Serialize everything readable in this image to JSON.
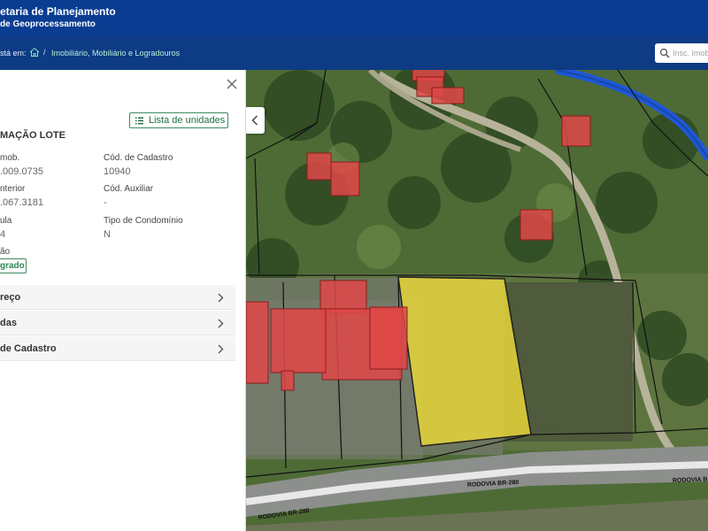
{
  "header": {
    "title_line1": "etaria de Planejamento",
    "title_line2": "de Geoprocessamento"
  },
  "breadcrumb": {
    "you_are_label": "stá em:",
    "separator": "/",
    "current": "Imobiliário, Mobiliário e Logradouros"
  },
  "search": {
    "placeholder": "Insc. Imob"
  },
  "panel": {
    "units_button_label": "Lista de unidades",
    "title": "MAÇÃO LOTE",
    "fields": [
      {
        "label": "mob.",
        "value": ".009.0735"
      },
      {
        "label": "Cód. de Cadastro",
        "value": "10940"
      },
      {
        "label": "nterior",
        "value": ".067.3181"
      },
      {
        "label": "Cód. Auxiliar",
        "value": "-"
      },
      {
        "label": "ula",
        "value": "4"
      },
      {
        "label": "Tipo de Condomínio",
        "value": "N"
      },
      {
        "label": "ão",
        "value": ""
      }
    ],
    "status_badge": "grado",
    "sections": [
      {
        "label": "reço"
      },
      {
        "label": "das"
      },
      {
        "label": "de Cadastro"
      }
    ]
  },
  "map": {
    "road_labels": [
      "RODOVIA BR-280",
      "RODOVIA B",
      "RODOVIA BR-280"
    ]
  },
  "colors": {
    "header_bg": "#0a3d91",
    "breadcrumb_bg": "#0d3b84",
    "accent_green": "#2c8a55",
    "building_red": "#e04848",
    "selected_lot_yellow": "#e8d83a",
    "river_blue": "#2060d8"
  }
}
